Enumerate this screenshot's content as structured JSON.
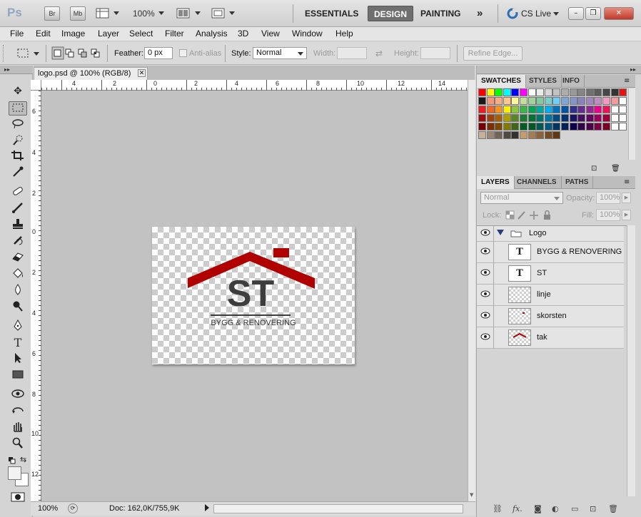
{
  "appbar": {
    "logo": "Ps",
    "bridge": "Br",
    "minibridge": "Mb",
    "zoom": "100%",
    "workspaces": [
      "ESSENTIALS",
      "DESIGN",
      "PAINTING"
    ],
    "more": "»",
    "cslive": "CS Live",
    "window_controls": {
      "minimize": "–",
      "restore": "❐",
      "close": "✕"
    }
  },
  "menu": [
    "File",
    "Edit",
    "Image",
    "Layer",
    "Select",
    "Filter",
    "Analysis",
    "3D",
    "View",
    "Window",
    "Help"
  ],
  "options": {
    "feather_label": "Feather:",
    "feather_value": "0 px",
    "antialias_label": "Anti-alias",
    "style_label": "Style:",
    "style_value": "Normal",
    "width_label": "Width:",
    "height_label": "Height:",
    "refine_edge": "Refine Edge..."
  },
  "document": {
    "tab_title": "logo.psd @ 100% (RGB/8)",
    "ruler_top": [
      "4",
      "2",
      "0",
      "2",
      "4",
      "6",
      "8",
      "10",
      "12",
      "14"
    ],
    "ruler_left": [
      "6",
      "4",
      "2",
      "0",
      "2",
      "4",
      "6",
      "8",
      "10",
      "12"
    ],
    "logo_text": "ST",
    "logo_subtitle": "BYGG & RENOVERING",
    "colors": {
      "roof": "#b00000",
      "text": "#3d3d3d"
    }
  },
  "status": {
    "zoom": "100%",
    "doc": "Doc: 162,0K/755,9K"
  },
  "swatches_panel": {
    "tabs": [
      "SWATCHES",
      "STYLES",
      "INFO"
    ],
    "colors": [
      [
        "#ff0000",
        "#ffff00",
        "#00ff00",
        "#00ffff",
        "#0000ff",
        "#ff00ff",
        "#ffffff",
        "#ebebeb",
        "#d6d6d6",
        "#c2c2c2",
        "#adadad",
        "#999999",
        "#858585",
        "#707070",
        "#5c5c5c",
        "#474747",
        "#333333",
        "#e31414"
      ],
      [
        "#1a1a1a",
        "#f7977a",
        "#f9ad81",
        "#fdc68a",
        "#fff79a",
        "#c4df9b",
        "#a2d39c",
        "#82ca9d",
        "#7bcdc8",
        "#6ecff6",
        "#7ea7d8",
        "#8493ca",
        "#8882be",
        "#a187be",
        "#bc8dbf",
        "#f49ac2",
        "#f6989d",
        "#ffffff"
      ],
      [
        "#ed1c24",
        "#f26522",
        "#f7941d",
        "#fff200",
        "#8dc63f",
        "#39b54a",
        "#00a651",
        "#00a99d",
        "#00aeef",
        "#0072bc",
        "#0054a6",
        "#2e3192",
        "#662d91",
        "#92278f",
        "#ec008c",
        "#ed145b",
        "#ffffff",
        "#ffffff"
      ],
      [
        "#9e0b0f",
        "#a0410d",
        "#a36209",
        "#aba000",
        "#598527",
        "#1a7b30",
        "#007236",
        "#00746b",
        "#0076a3",
        "#004b80",
        "#003471",
        "#1b1464",
        "#440e62",
        "#630460",
        "#9e005d",
        "#9e0039",
        "#ffffff",
        "#ffffff"
      ],
      [
        "#790000",
        "#7b2e00",
        "#7d4900",
        "#827b00",
        "#406618",
        "#005e20",
        "#005826",
        "#005952",
        "#005b7f",
        "#003663",
        "#002157",
        "#0d004c",
        "#32004b",
        "#4b0049",
        "#7b0046",
        "#7a0026",
        "#ffffff",
        "#ffffff"
      ],
      [
        "#c7b299",
        "#998675",
        "#736357",
        "#534741",
        "#37302a",
        "#c69c6d",
        "#a67c52",
        "#8c6239",
        "#754c24",
        "#603913"
      ]
    ]
  },
  "layers_panel": {
    "tabs": [
      "LAYERS",
      "CHANNELS",
      "PATHS"
    ],
    "blend_mode": "Normal",
    "opacity_label": "Opacity:",
    "opacity_value": "100%",
    "lock_label": "Lock:",
    "fill_label": "Fill:",
    "fill_value": "100%",
    "group_name": "Logo",
    "layers": [
      {
        "name": "BYGG & RENOVERING",
        "type": "text"
      },
      {
        "name": "ST",
        "type": "text"
      },
      {
        "name": "linje",
        "type": "raster"
      },
      {
        "name": "skorsten",
        "type": "raster"
      },
      {
        "name": "tak",
        "type": "raster"
      }
    ]
  }
}
